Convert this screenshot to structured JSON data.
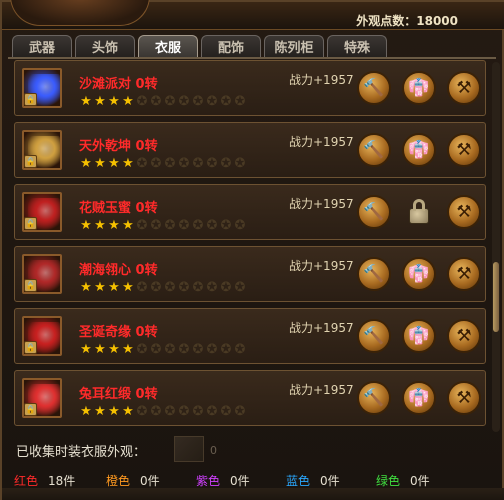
{
  "header": {
    "score_label": "外观点数：18000"
  },
  "tabs": [
    {
      "label": "武器",
      "active": false
    },
    {
      "label": "头饰",
      "active": false
    },
    {
      "label": "衣服",
      "active": true
    },
    {
      "label": "配饰",
      "active": false
    },
    {
      "label": "陈列柜",
      "active": false
    },
    {
      "label": "特殊",
      "active": false
    }
  ],
  "items": [
    {
      "name": "沙滩派对 0转",
      "stars_filled": 4,
      "stars_total": 12,
      "power": "战力+1957",
      "third_button": "forge",
      "art_color": "#3a5cff"
    },
    {
      "name": "天外乾坤 0转",
      "stars_filled": 4,
      "stars_total": 12,
      "power": "战力+1957",
      "third_button": "forge",
      "art_color": "#d0a040"
    },
    {
      "name": "花贼玉蜜 0转",
      "stars_filled": 4,
      "stars_total": 12,
      "power": "战力+1957",
      "third_button": "lock",
      "art_color": "#c02020"
    },
    {
      "name": "潮海翎心 0转",
      "stars_filled": 4,
      "stars_total": 12,
      "power": "战力+1957",
      "third_button": "forge",
      "art_color": "#b02828"
    },
    {
      "name": "圣诞奇缘 0转",
      "stars_filled": 4,
      "stars_total": 12,
      "power": "战力+1957",
      "third_button": "forge",
      "art_color": "#c82020"
    },
    {
      "name": "兔耳红缎 0转",
      "stars_filled": 4,
      "stars_total": 12,
      "power": "战力+1957",
      "third_button": "forge",
      "art_color": "#e03030"
    }
  ],
  "icons": {
    "upgrade": "hammer-icon",
    "wear": "outfit-icon",
    "forge": "anvil-icon",
    "lock": "padlock-icon"
  },
  "summary": {
    "title": "已收集时装衣服外观：",
    "zero": "0"
  },
  "counts": [
    {
      "label": "红色",
      "value": "18件",
      "color": "#ff2a2a"
    },
    {
      "label": "橙色",
      "value": "0件",
      "color": "#ff9a20"
    },
    {
      "label": "紫色",
      "value": "0件",
      "color": "#d040ff"
    },
    {
      "label": "蓝色",
      "value": "0件",
      "color": "#2aa8ff"
    },
    {
      "label": "绿色",
      "value": "0件",
      "color": "#40e040"
    }
  ]
}
